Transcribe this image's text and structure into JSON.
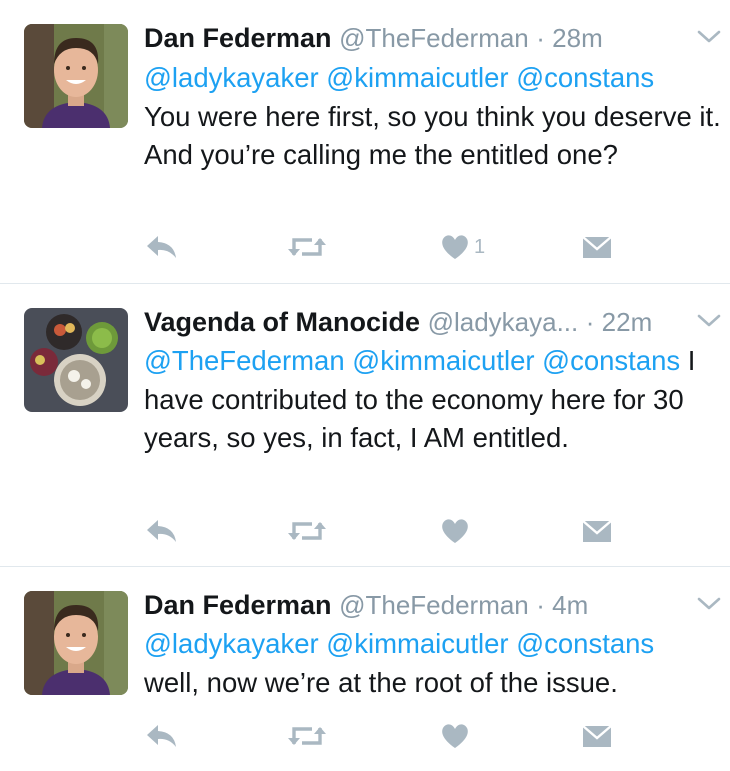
{
  "tweets": [
    {
      "name": "Dan Federman",
      "handle": "@TheFederman",
      "time": "· 28m",
      "line1": [
        "@ladykayaker",
        "@kimmaicutler",
        "@constans"
      ],
      "rest": "You were here first, so you think you deserve it. And you’re calling me the entitled one?",
      "like_count": "1",
      "avatar": "profile-photo-dan"
    },
    {
      "name": "Vagenda of Manocide",
      "handle": "@ladykaya...",
      "time": "· 22m",
      "mentions": [
        "@TheFederman",
        "@kimmaicutler",
        "@constans"
      ],
      "rest": "I have contributed to the economy here for 30 years, so yes, in fact, I AM entitled.",
      "avatar": "profile-photo-food"
    },
    {
      "name": "Dan Federman",
      "handle": "@TheFederman",
      "time": "· 4m",
      "line1": [
        "@ladykayaker",
        "@kimmaicutler",
        "@constans"
      ],
      "rest": "well, now we’re at the root of the issue.",
      "avatar": "profile-photo-dan"
    }
  ],
  "icons": {
    "reply": "reply-icon",
    "retweet": "retweet-icon",
    "like": "heart-icon",
    "dm": "direct-message-icon",
    "menu": "chevron-down-icon"
  },
  "colors": {
    "link": "#1da1f2",
    "muted": "#8899a6",
    "icon": "#aab8c2"
  }
}
